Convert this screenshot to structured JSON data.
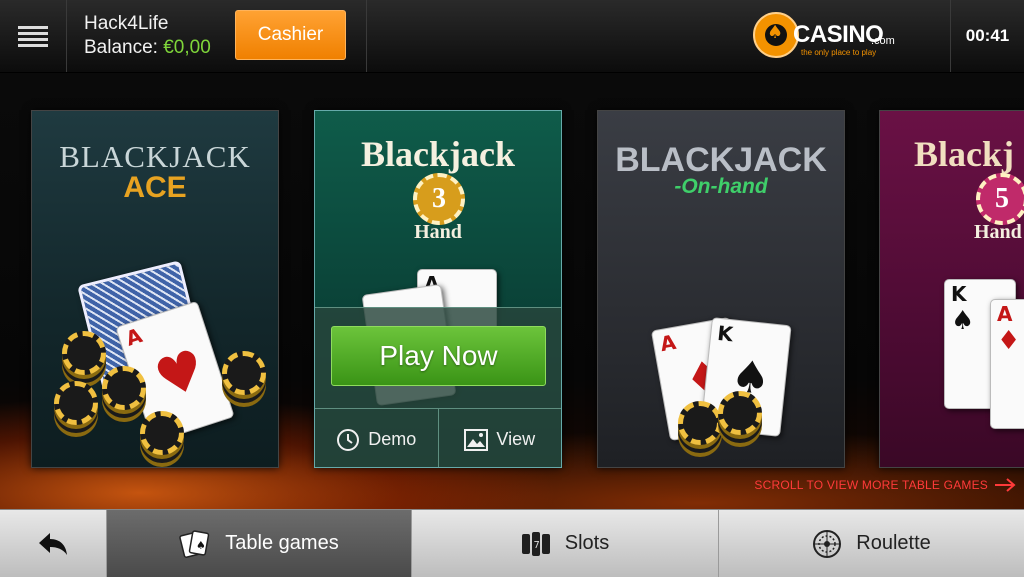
{
  "header": {
    "username": "Hack4Life",
    "balance_label": "Balance:",
    "balance_value": "€0,00",
    "cashier_label": "Cashier",
    "logo_text": "CASINO",
    "logo_domain": ".com",
    "logo_tagline": "the only place to play",
    "clock": "00:41"
  },
  "games": [
    {
      "title_line1": "BLACKJACK",
      "title_line2": "ACE"
    },
    {
      "title": "Blackjack",
      "badge": "3",
      "subtitle": "Hand"
    },
    {
      "title_line1": "BLACKJACK",
      "title_line2": "-On-hand"
    },
    {
      "title": "Blackj",
      "badge": "5",
      "subtitle": "Hand"
    }
  ],
  "card_ranks": {
    "ace": "A",
    "king": "K"
  },
  "overlay": {
    "play_now": "Play Now",
    "demo": "Demo",
    "view": "View"
  },
  "scroll_hint": "SCROLL TO VIEW MORE TABLE GAMES",
  "bottom_nav": {
    "table_games": "Table games",
    "slots": "Slots",
    "roulette": "Roulette",
    "active": "table_games"
  },
  "colors": {
    "balance": "#7fd63a",
    "cashier": "#f08000",
    "play_now": "#4fa825",
    "scroll_hint": "#ff3a3a",
    "logo_accent": "#f39200"
  }
}
